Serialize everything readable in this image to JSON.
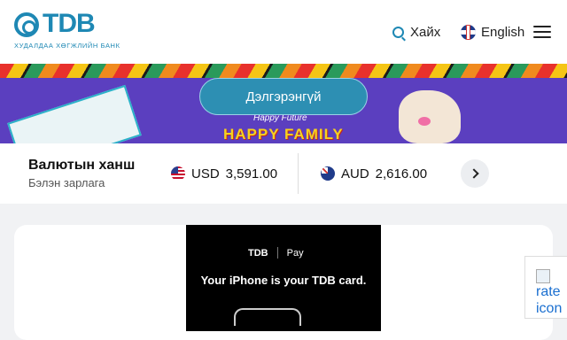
{
  "header": {
    "logo_text": "TDB",
    "logo_subtitle": "ХУДАЛДАА ХӨГЖЛИЙН БАНК",
    "search_label": "Хайх",
    "language_label": "English"
  },
  "banner": {
    "button_label": "Дэлгэрэнгүй",
    "subtitle": "Happy Future",
    "title": "HAPPY FAMILY"
  },
  "rates": {
    "title": "Валютын ханш",
    "subtitle": "Бэлэн зарлага",
    "currencies": [
      {
        "code": "USD",
        "value": "3,591.00"
      },
      {
        "code": "AUD",
        "value": "2,616.00"
      }
    ]
  },
  "ad": {
    "brand": "TDB",
    "pay": "Pay",
    "text": "Your iPhone is your TDB card."
  },
  "side_widget": {
    "text": "rate icon"
  },
  "colors": {
    "brand": "#1e88b4",
    "banner": "#5b3fbf"
  }
}
